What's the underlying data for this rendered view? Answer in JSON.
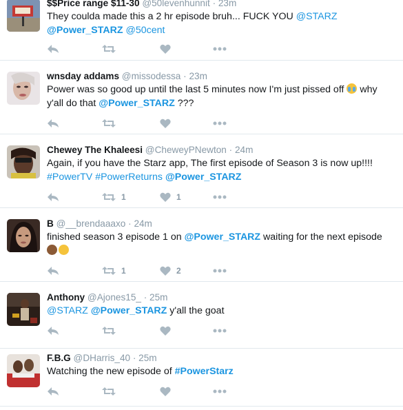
{
  "tweets": [
    {
      "name": "$$Price range $11-30",
      "handle": "@50levenhunnit",
      "time": "23m",
      "line1_pre": "They coulda made this a 2 hr episode bruh... FUCK YOU ",
      "line1_link": "@STARZ",
      "line2_link1": "@Power_STARZ",
      "line2_link2": "@50cent",
      "retweets": "",
      "likes": ""
    },
    {
      "name": "wnsday addams",
      "handle": "@missodessa",
      "time": "23m",
      "line1_pre": "Power was so good up until the last 5 minutes now I'm just pissed off ",
      "line1_post": " why",
      "line2_pre": "y'all do that ",
      "line2_link": "@Power_STARZ",
      "line2_post": " ???",
      "emoji": "crying-face-emoji",
      "retweets": "",
      "likes": ""
    },
    {
      "name": "Chewey The Khaleesi",
      "handle": "@CheweyPNewton",
      "time": "24m",
      "line1": "Again, if you have the Starz app, The first episode of Season 3 is now up!!!!",
      "line2_link1": "#PowerTV",
      "line2_link2": "#PowerReturns",
      "line2_link3": "@Power_STARZ",
      "retweets": "1",
      "likes": "1"
    },
    {
      "name": "B",
      "handle": "@__brendaaaxo",
      "time": "24m",
      "line1_pre": "finished season 3 episode 1 on ",
      "line1_link": "@Power_STARZ",
      "line1_post": " waiting for the next episode",
      "emoji1": "fist-emoji",
      "emoji2": "smirk-emoji",
      "retweets": "1",
      "likes": "2"
    },
    {
      "name": "Anthony",
      "handle": "@Ajones15_",
      "time": "25m",
      "line1_link1": "@STARZ",
      "line1_link2": "@Power_STARZ",
      "line1_post": " y'all the goat",
      "retweets": "",
      "likes": ""
    },
    {
      "name": "F.B.G",
      "handle": "@DHarris_40",
      "time": "25m",
      "line1_pre": "Watching the new episode of ",
      "line1_link": "#PowerStarz",
      "retweets": "",
      "likes": ""
    }
  ],
  "icons": {
    "reply": "reply-icon",
    "retweet": "retweet-icon",
    "like": "heart-icon",
    "more": "more-icon"
  },
  "colors": {
    "link": "#1b95e0",
    "meta": "#8899a6",
    "action": "#aab8c2",
    "divider": "#e1e8ed"
  }
}
